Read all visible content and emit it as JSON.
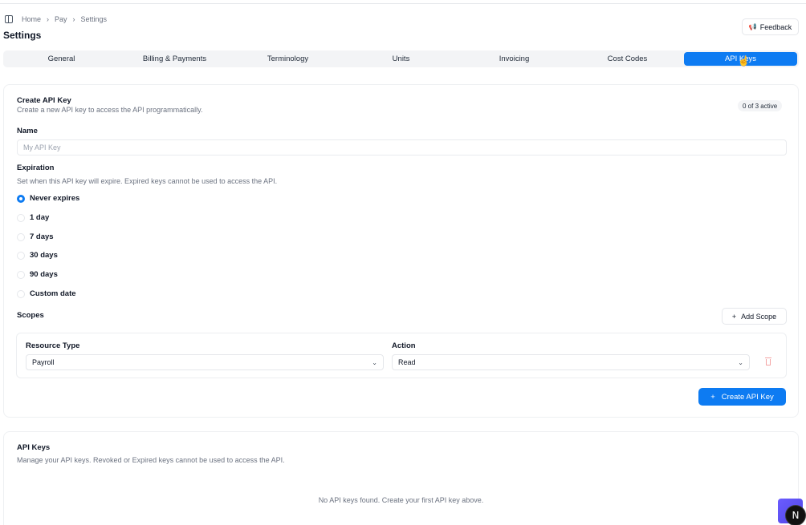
{
  "breadcrumb": {
    "items": [
      "Home",
      "Pay",
      "Settings"
    ]
  },
  "page": {
    "title": "Settings"
  },
  "header": {
    "feedback_label": "Feedback"
  },
  "tabs": [
    {
      "label": "General",
      "active": false
    },
    {
      "label": "Billing & Payments",
      "active": false
    },
    {
      "label": "Terminology",
      "active": false
    },
    {
      "label": "Units",
      "active": false
    },
    {
      "label": "Invoicing",
      "active": false
    },
    {
      "label": "Cost Codes",
      "active": false
    },
    {
      "label": "API Keys",
      "active": true
    }
  ],
  "create_card": {
    "title": "Create API Key",
    "description": "Create a new API key to access the API programmatically.",
    "active_badge": "0 of 3 active",
    "name_label": "Name",
    "name_placeholder": "My API Key",
    "expiration_label": "Expiration",
    "expiration_description": "Set when this API key will expire. Expired keys cannot be used to access the API.",
    "expiration_options": [
      {
        "label": "Never expires",
        "checked": true
      },
      {
        "label": "1 day",
        "checked": false
      },
      {
        "label": "7 days",
        "checked": false
      },
      {
        "label": "30 days",
        "checked": false
      },
      {
        "label": "90 days",
        "checked": false
      },
      {
        "label": "Custom date",
        "checked": false
      }
    ],
    "scopes_label": "Scopes",
    "add_scope_label": "Add Scope",
    "scope": {
      "resource_type_label": "Resource Type",
      "resource_type_value": "Payroll",
      "action_label": "Action",
      "action_value": "Read"
    },
    "create_button_label": "Create API Key"
  },
  "keys_card": {
    "title": "API Keys",
    "description": "Manage your API keys. Revoked or Expired keys cannot be used to access the API.",
    "empty_message": "No API keys found. Create your first API key above."
  },
  "dev_badge_letter": "N",
  "colors": {
    "accent": "#0d7bf2",
    "delete": "#f4a3a3"
  }
}
